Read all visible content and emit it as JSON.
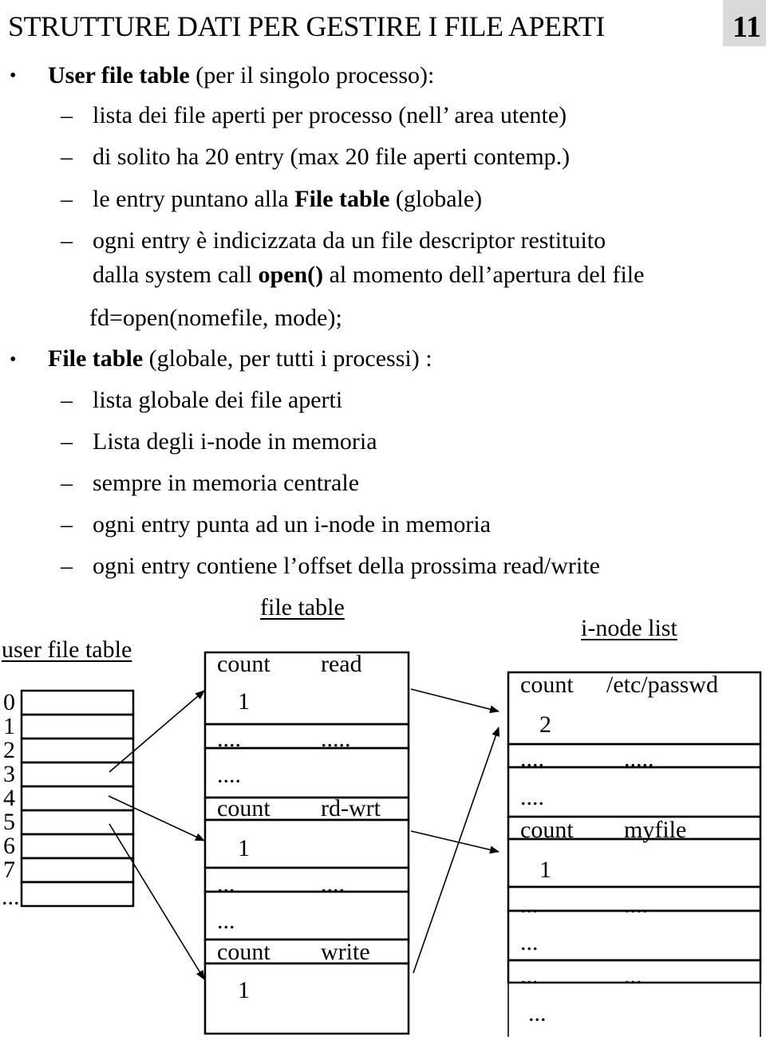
{
  "slide": {
    "title": "STRUTTURE DATI PER GESTIRE I FILE APERTI",
    "page_number": "11"
  },
  "bullets": [
    {
      "bold": "User file table",
      "rest": " (per il singolo processo):",
      "sub": [
        "lista dei file aperti per processo (nell’ area utente)",
        "di solito ha 20 entry (max 20 file aperti contemp.)",
        {
          "pre": "le entry puntano alla ",
          "bold": "File table",
          "post": " (globale)"
        },
        "ogni entry è indicizzata da un file descriptor restituito",
        {
          "pre": "dalla system call ",
          "bold": "open()",
          "post": " al momento dell’apertura del file"
        }
      ],
      "code": "fd=open(nomefile, mode);"
    },
    {
      "bold": "File table",
      "rest": " (globale, per tutti i processi) :",
      "sub": [
        "lista globale dei file aperti",
        "Lista degli i-node in memoria",
        "sempre in memoria centrale",
        "ogni entry punta ad un i-node in memoria",
        "ogni entry contiene l’offset della prossima read/write"
      ]
    }
  ],
  "diagram": {
    "user_file_table": {
      "label": "user file table",
      "indices": [
        "0",
        "1",
        "2",
        "3",
        "4",
        "5",
        "6",
        "7",
        "..."
      ]
    },
    "file_table": {
      "label": "file table",
      "cells": [
        {
          "a": "count",
          "b": "read"
        },
        {
          "a": "1",
          "b": ""
        },
        {
          "a": "....",
          "b": "....."
        },
        {
          "a": "....",
          "b": ""
        },
        {
          "a": "count",
          "b": "rd-wrt"
        },
        {
          "a": "1",
          "b": ""
        },
        {
          "a": "...",
          "b": "...."
        },
        {
          "a": "...",
          "b": ""
        },
        {
          "a": "count",
          "b": "write"
        },
        {
          "a": "1",
          "b": ""
        }
      ]
    },
    "inode_list": {
      "label": "i-node list",
      "cells": [
        {
          "a": "count",
          "b": "/etc/passwd"
        },
        {
          "a": "2",
          "b": ""
        },
        {
          "a": "....",
          "b": "....."
        },
        {
          "a": "....",
          "b": ""
        },
        {
          "a": "count",
          "b": "myfile"
        },
        {
          "a": "1",
          "b": ""
        },
        {
          "a": "...",
          "b": "...."
        },
        {
          "a": "...",
          "b": ""
        },
        {
          "a": "...",
          "b": "..."
        },
        {
          "a": "...",
          "b": ""
        }
      ]
    },
    "pointers": [
      {
        "from": "user-fd-3",
        "to": "file-table-read"
      },
      {
        "from": "user-fd-4",
        "to": "file-table-rd-wrt"
      },
      {
        "from": "user-fd-5",
        "to": "file-table-write"
      },
      {
        "from": "file-table-read",
        "to": "inode-etc-passwd"
      },
      {
        "from": "file-table-write",
        "to": "inode-etc-passwd"
      },
      {
        "from": "file-table-rd-wrt",
        "to": "inode-myfile"
      }
    ]
  }
}
